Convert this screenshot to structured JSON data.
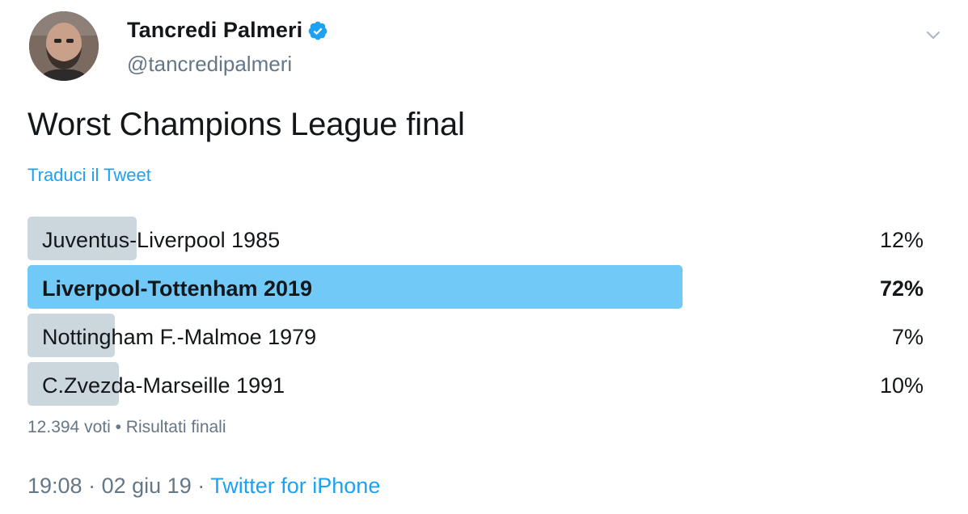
{
  "author": {
    "display_name": "Tancredi Palmeri",
    "handle": "@tancredipalmeri",
    "verified": true
  },
  "tweet": {
    "text": "Worst Champions League final",
    "translate_link": "Traduci il Tweet"
  },
  "poll": {
    "options": [
      {
        "label": "Juventus-Liverpool 1985",
        "percent_text": "12%",
        "percent": 12,
        "winner": false
      },
      {
        "label": "Liverpool-Tottenham 2019",
        "percent_text": "72%",
        "percent": 72,
        "winner": true
      },
      {
        "label": "Nottingham F.-Malmoe 1979",
        "percent_text": "7%",
        "percent": 7,
        "winner": false
      },
      {
        "label": "C.Zvezda-Marseille 1991",
        "percent_text": "10%",
        "percent": 10,
        "winner": false
      }
    ],
    "votes": "12.394 voti",
    "separator": "•",
    "status": "Risultati finali"
  },
  "footer": {
    "time": "19:08",
    "date": "02 giu 19",
    "separator": "·",
    "source": "Twitter for iPhone"
  },
  "icons": {
    "verified": "verified-badge-icon",
    "menu": "chevron-down-icon"
  },
  "colors": {
    "link": "#1da1f2",
    "muted": "#657786",
    "winner_bar": "#71c9f8",
    "bar": "#ccd6dd"
  }
}
